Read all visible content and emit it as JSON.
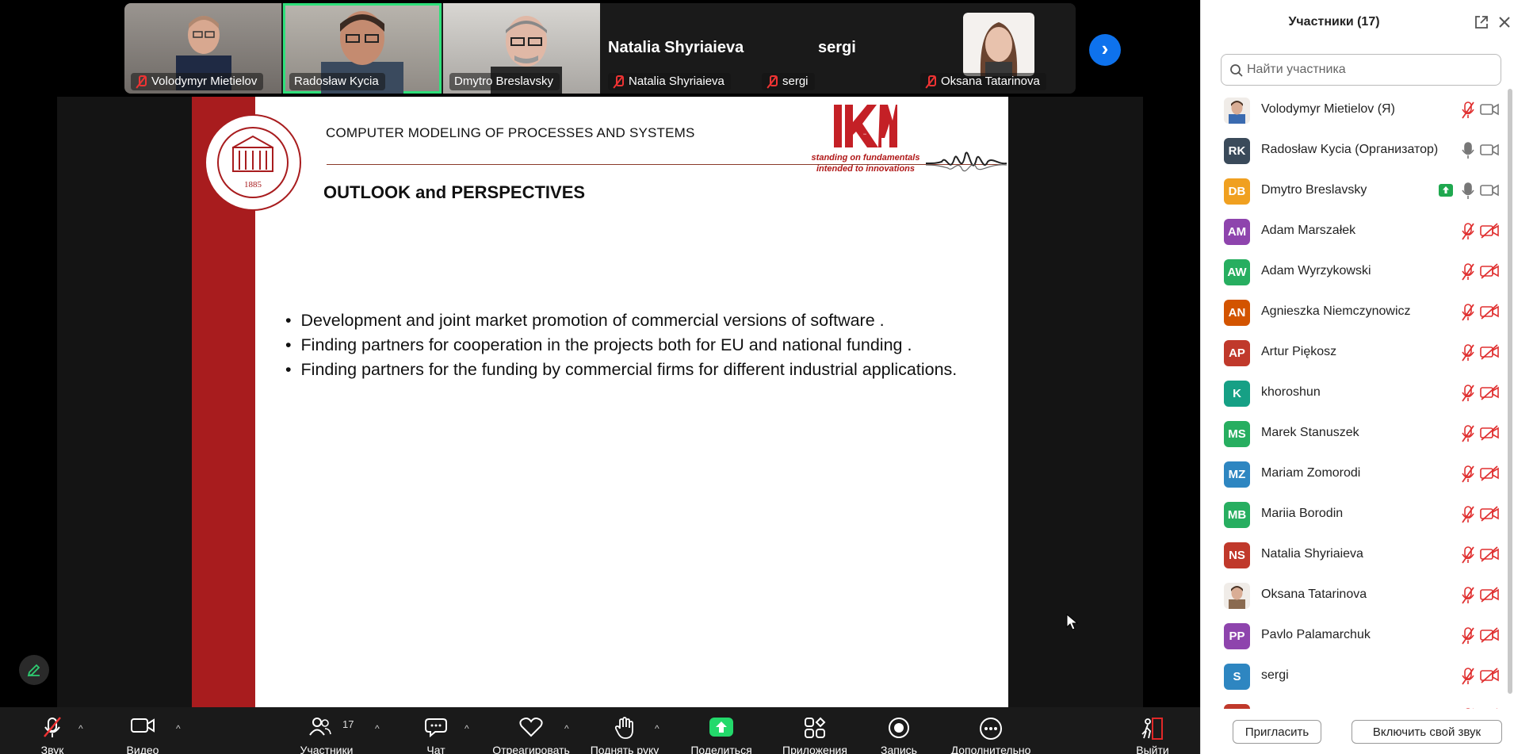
{
  "video_strip": {
    "tiles": [
      {
        "name": "Volodymyr Mietielov",
        "muted": true
      },
      {
        "name": "Radosław Kycia",
        "muted": false,
        "active_speaker": true
      },
      {
        "name": "Dmytro Breslavsky",
        "muted": false
      },
      {
        "name": "Natalia Shyriaieva",
        "big_name": "Natalia Shyriaieva",
        "muted": true
      },
      {
        "name": "sergi",
        "big_name": "sergi",
        "muted": true
      },
      {
        "name": "Oksana Tatarinova",
        "muted": true
      }
    ],
    "next_page_icon": "chevron-right-icon"
  },
  "slide": {
    "header": "COMPUTER MODELING OF PROCESSES AND SYSTEMS",
    "seal_year": "1885",
    "logo_text": "IKM",
    "tagline_1": "standing on fundamentals",
    "tagline_2": "intended to innovations",
    "title": "OUTLOOK and PERSPECTIVES",
    "bullets": [
      "Development and joint market promotion of  commercial versions of software .",
      "Finding partners  for cooperation in  the projects both for EU and  national funding .",
      "Finding partners for the funding by commercial firms for different industrial applications."
    ],
    "bullet_char": "•",
    "accent_color": "#a81c1e"
  },
  "toolbar": {
    "audio": "Звук",
    "video": "Видео",
    "participants": "Участники",
    "participants_count": "17",
    "chat": "Чат",
    "react": "Отреагировать",
    "raise_hand": "Поднять руку",
    "share": "Поделиться",
    "apps": "Приложения",
    "record": "Запись",
    "more": "Дополнительно",
    "leave": "Выйти"
  },
  "panel": {
    "title": "Участники (17)",
    "search_placeholder": "Найти участника",
    "participants": [
      {
        "initials": "",
        "name": "Volodymyr Mietielov (Я)",
        "color": "#3b6bb0",
        "photo": true,
        "mic": "off",
        "video": "on"
      },
      {
        "initials": "RK",
        "name": "Radosław Kycia (Организатор)",
        "color": "#3a4a5a",
        "mic": "on",
        "video": "on"
      },
      {
        "initials": "DB",
        "name": "Dmytro Breslavsky",
        "color": "#f0a020",
        "mic": "on",
        "video": "on",
        "sharing": true
      },
      {
        "initials": "AM",
        "name": "Adam Marszałek",
        "color": "#8e44ad",
        "mic": "off",
        "video": "off"
      },
      {
        "initials": "AW",
        "name": "Adam Wyrzykowski",
        "color": "#27ae60",
        "mic": "off",
        "video": "off"
      },
      {
        "initials": "AN",
        "name": "Agnieszka Niemczynowicz",
        "color": "#d35400",
        "mic": "off",
        "video": "off"
      },
      {
        "initials": "AP",
        "name": "Artur Piękosz",
        "color": "#c0392b",
        "mic": "off",
        "video": "off"
      },
      {
        "initials": "K",
        "name": "khoroshun",
        "color": "#16a085",
        "mic": "off",
        "video": "off"
      },
      {
        "initials": "MS",
        "name": "Marek Stanuszek",
        "color": "#27ae60",
        "mic": "off",
        "video": "off"
      },
      {
        "initials": "MZ",
        "name": "Mariam Zomorodi",
        "color": "#2e86c1",
        "mic": "off",
        "video": "off"
      },
      {
        "initials": "MB",
        "name": "Mariia Borodin",
        "color": "#27ae60",
        "mic": "off",
        "video": "off"
      },
      {
        "initials": "NS",
        "name": "Natalia Shyriaieva",
        "color": "#c0392b",
        "mic": "off",
        "video": "off"
      },
      {
        "initials": "",
        "name": "Oksana Tatarinova",
        "color": "#8a6a50",
        "photo": true,
        "mic": "off",
        "video": "off"
      },
      {
        "initials": "PP",
        "name": "Pavlo Palamarchuk",
        "color": "#8e44ad",
        "mic": "off",
        "video": "off"
      },
      {
        "initials": "S",
        "name": "sergi",
        "color": "#2e86c1",
        "mic": "off",
        "video": "off"
      },
      {
        "initials": "",
        "name": "",
        "color": "#c0392b",
        "mic": "off",
        "video": "off"
      }
    ],
    "invite": "Пригласить",
    "unmute_me": "Включить свой звук"
  }
}
